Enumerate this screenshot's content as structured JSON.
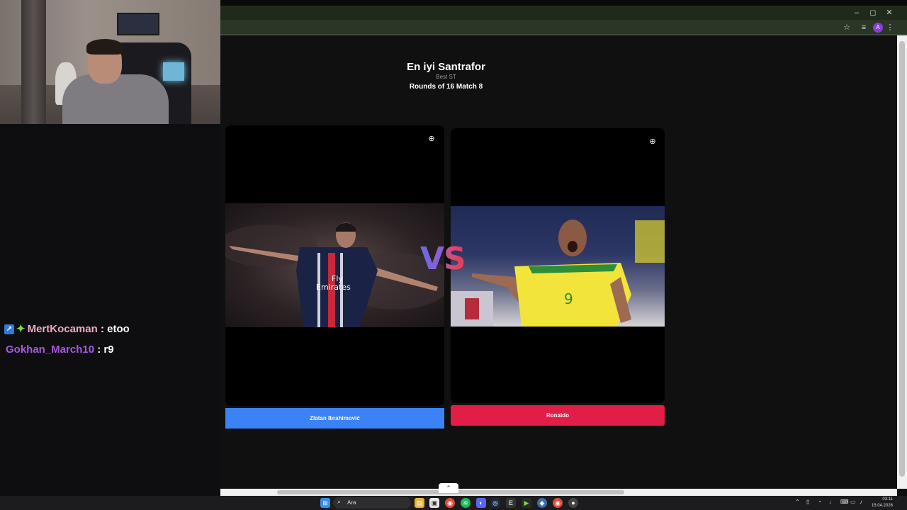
{
  "quiz": {
    "title": "En iyi Santrafor",
    "subtitle": "Best ST",
    "round": "Rounds of 16 Match 8",
    "vs": "VS"
  },
  "contenders": [
    {
      "name": "Zlatan Ibrahimović",
      "jersey_text": "Fly\nEmirates",
      "color": "#3b82f6"
    },
    {
      "name": "Ronaldo",
      "jersey_number": "9",
      "color": "#e11d48"
    }
  ],
  "chat": {
    "messages": [
      {
        "user": "MertKocaman",
        "separator": " : ",
        "text": "etoo",
        "user_color": "#f0a8c8",
        "badges": [
          "verified-icon",
          "sparkle-icon"
        ]
      },
      {
        "user": "Gokhan_March10",
        "separator": " : ",
        "text": "r9",
        "user_color": "#a45ae0",
        "badges": []
      }
    ]
  },
  "browser": {
    "window_controls": {
      "minimize": "–",
      "maximize": "◻",
      "close": "✕"
    },
    "profile_initial": "A"
  },
  "taskbar": {
    "search_placeholder": "Ara",
    "time": "03:11",
    "date": "15.04.2026"
  }
}
